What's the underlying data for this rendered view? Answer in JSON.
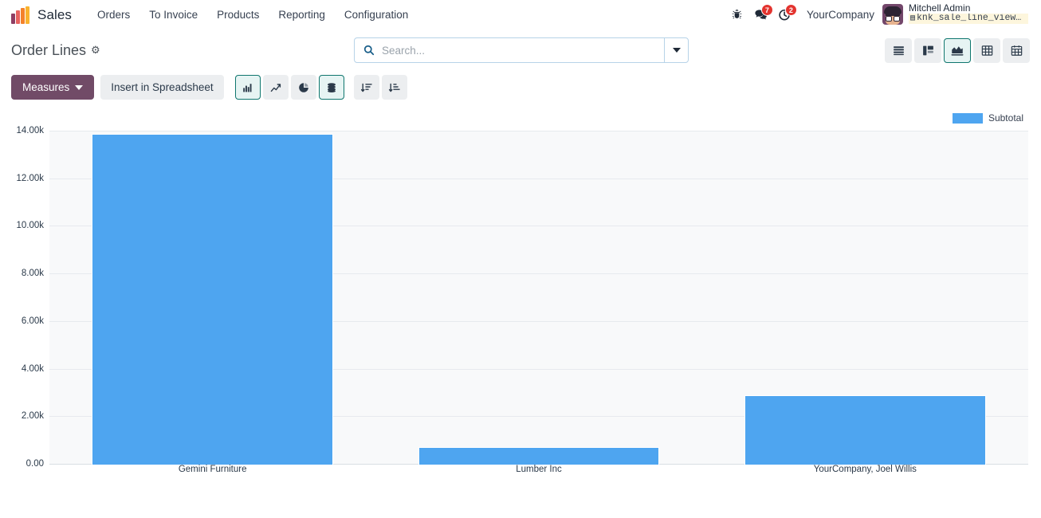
{
  "navbar": {
    "app_logo_icon": "sales-app-logo-icon",
    "app_name": "Sales",
    "menu_items": [
      {
        "label": "Orders"
      },
      {
        "label": "To Invoice"
      },
      {
        "label": "Products"
      },
      {
        "label": "Reporting"
      },
      {
        "label": "Configuration"
      }
    ],
    "system_icons": [
      {
        "name": "bug-icon",
        "badge": ""
      },
      {
        "name": "messages-icon",
        "badge": "7"
      },
      {
        "name": "activities-clock-icon",
        "badge": "2"
      }
    ],
    "company_name": "YourCompany",
    "user": {
      "avatar_name": "avatar",
      "name": "Mitchell Admin",
      "database_icon": "database-icon",
      "database": "knk_sale_line_views_impo…"
    }
  },
  "control_panel": {
    "title": "Order Lines",
    "gear_icon": "gear-icon",
    "search": {
      "icon": "search-icon",
      "placeholder": "Search...",
      "value": "",
      "toggle_icon": "chevron-down-icon"
    },
    "views": [
      {
        "name": "view-list",
        "icon": "list-icon",
        "active": false
      },
      {
        "name": "view-kanban",
        "icon": "kanban-icon",
        "active": false
      },
      {
        "name": "view-graph",
        "icon": "graph-icon",
        "active": true
      },
      {
        "name": "view-pivot",
        "icon": "pivot-icon",
        "active": false
      },
      {
        "name": "view-calendar",
        "icon": "calendar-icon",
        "active": false
      }
    ]
  },
  "graph_toolbar": {
    "measures_label": "Measures",
    "measures_caret_icon": "caret-down-icon",
    "spreadsheet_label": "Insert in Spreadsheet",
    "chart_buttons": [
      {
        "name": "bar-chart-button",
        "icon": "bar-chart-icon",
        "active": true
      },
      {
        "name": "line-chart-button",
        "icon": "line-chart-icon",
        "active": false
      },
      {
        "name": "pie-chart-button",
        "icon": "pie-chart-icon",
        "active": false
      },
      {
        "name": "stacked-button",
        "icon": "stacked-database-icon",
        "active": true
      },
      {
        "name": "sort-descending-button",
        "icon": "sort-descending-icon",
        "active": false
      },
      {
        "name": "sort-ascending-button",
        "icon": "sort-ascending-icon",
        "active": false
      }
    ]
  },
  "chart_data": {
    "type": "bar",
    "title": "",
    "xlabel": "",
    "ylabel": "",
    "categories": [
      "Gemini Furniture",
      "Lumber Inc",
      "YourCompany, Joel Willis"
    ],
    "series": [
      {
        "name": "Subtotal",
        "color": "#4ea5f0",
        "values": [
          13900,
          740,
          2930
        ]
      }
    ],
    "ylim": [
      0,
      14000
    ],
    "yticks": [
      0,
      2000,
      4000,
      6000,
      8000,
      10000,
      12000,
      14000
    ],
    "ytick_labels": [
      "0.00",
      "2.00k",
      "4.00k",
      "6.00k",
      "8.00k",
      "10.00k",
      "12.00k",
      "14.00k"
    ],
    "grid": true,
    "legend": {
      "position": "top-right",
      "entries": [
        "Subtotal"
      ]
    }
  },
  "colors": {
    "brand_purple": "#714b67",
    "bar_blue": "#4ea5f0",
    "accent_teal": "#0f766e",
    "badge_red": "#e3342f",
    "db_badge_bg": "#fdf6dd"
  }
}
